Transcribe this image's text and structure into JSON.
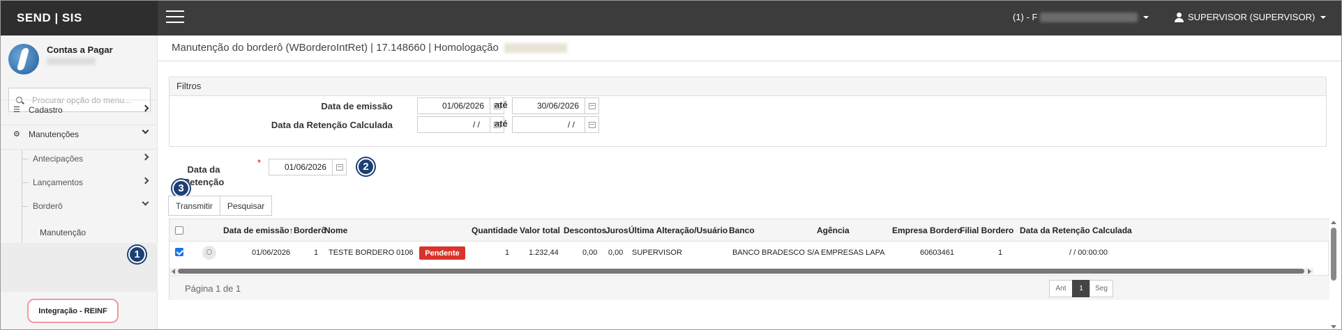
{
  "topbar": {
    "brand": "SEND | SIS",
    "company_prefix": "(1) - F",
    "user": "SUPERVISOR (SUPERVISOR)"
  },
  "sidebar": {
    "module_title": "Contas a Pagar",
    "search_placeholder": "Procurar opção do menu...",
    "items": [
      {
        "label": "Cadastro"
      },
      {
        "label": "Manutenções"
      }
    ],
    "sub_items": [
      {
        "label": "Antecipações"
      },
      {
        "label": "Lançamentos"
      },
      {
        "label": "Borderô"
      }
    ],
    "leaf_items": [
      {
        "label": "Manutenção"
      },
      {
        "label": "Integração - REINF"
      }
    ]
  },
  "page": {
    "title": "Manutenção do borderô (WBorderoIntRet) | 17.148660 | Homologação"
  },
  "filters": {
    "header": "Filtros",
    "emissao_label": "Data de emissão",
    "emissao_from": "01/06/2026",
    "emissao_to": "30/06/2026",
    "retencao_label": "Data da Retenção Calculada",
    "retencao_from": "/ /",
    "retencao_to": "/ /",
    "ate": "até"
  },
  "form": {
    "retencao_label_1": "Data da",
    "retencao_label_2": "Retenção",
    "required_mark": "*",
    "retencao_value": "01/06/2026"
  },
  "badges": [
    "1",
    "2",
    "3"
  ],
  "buttons": {
    "transmitir": "Transmitir",
    "pesquisar": "Pesquisar"
  },
  "grid": {
    "columns": [
      "Data de emissão",
      "Borderô",
      "Nome",
      "Quantidade",
      "Valor total",
      "Descontos",
      "Juros",
      "Última Alteração/Usuário",
      "Banco",
      "Agência",
      "Empresa Bordero",
      "Filial Bordero",
      "Data da Retenção Calculada"
    ],
    "sort_arrow": "↑",
    "rows": [
      {
        "data_emissao": "01/06/2026",
        "bordero": "1",
        "nome": "TESTE BORDERO 0106",
        "status": "Pendente",
        "quantidade": "1",
        "valor_total": "1.232,44",
        "descontos": "0,00",
        "juros": "0,00",
        "usuario": "SUPERVISOR",
        "banco": "BANCO BRADESCO S/A",
        "agencia": "EMPRESAS LAPA",
        "empresa": "60603461",
        "filial": "1",
        "data_retencao": "/ / 00:00:00"
      }
    ]
  },
  "pager": {
    "text": "Página 1 de 1",
    "prev": "Ant",
    "current": "1",
    "next": "Seg"
  },
  "colors": {
    "topbar": "#3c3c3c",
    "brand_bg": "#2e2e2e",
    "badge": "#1c3f74",
    "status_pending": "#d9342b",
    "highlight": "#f19aa0"
  }
}
